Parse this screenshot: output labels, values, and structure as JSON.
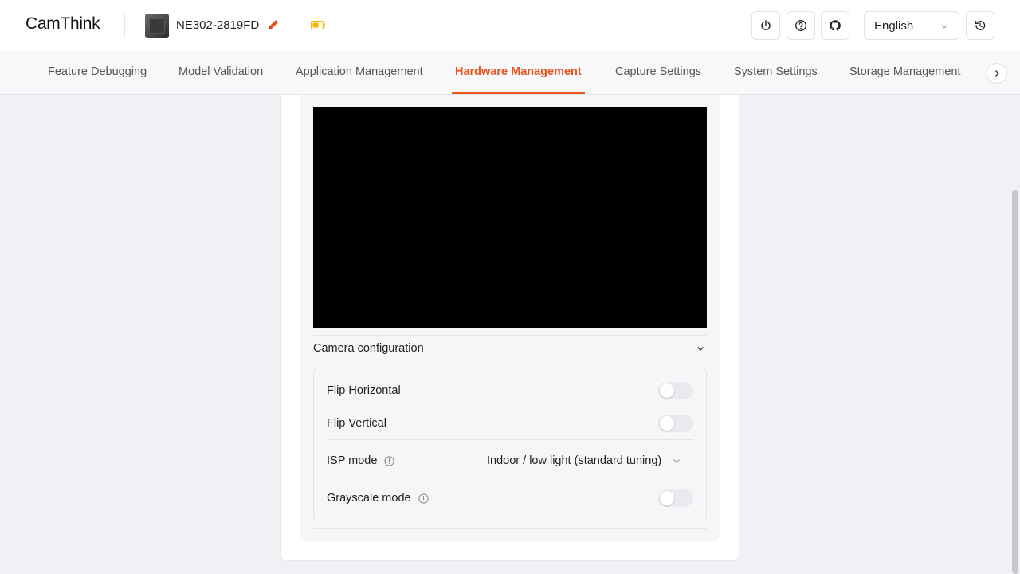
{
  "header": {
    "logo_text": "CamThink",
    "device_name": "NE302-2819FD",
    "language": "English",
    "icons": {
      "power": "power-icon",
      "help": "help-icon",
      "github": "github-icon",
      "history": "history-icon",
      "edit": "edit-icon",
      "battery": "battery-icon"
    }
  },
  "nav": {
    "tabs": [
      {
        "label": "Feature Debugging"
      },
      {
        "label": "Model Validation"
      },
      {
        "label": "Application Management"
      },
      {
        "label": "Hardware Management"
      },
      {
        "label": "Capture Settings"
      },
      {
        "label": "System Settings"
      },
      {
        "label": "Storage Management"
      }
    ],
    "active_tab": "Hardware Management"
  },
  "camera": {
    "section_title": "Camera configuration",
    "rows": {
      "flip_horizontal": {
        "label": "Flip Horizontal",
        "enabled": false
      },
      "flip_vertical": {
        "label": "Flip Vertical",
        "enabled": false
      },
      "isp_mode": {
        "label": "ISP mode",
        "value": "Indoor / low light (standard tuning)"
      },
      "grayscale": {
        "label": "Grayscale mode",
        "enabled": false
      }
    }
  },
  "colors": {
    "accent": "#e8531e",
    "battery": "#f5b800"
  }
}
